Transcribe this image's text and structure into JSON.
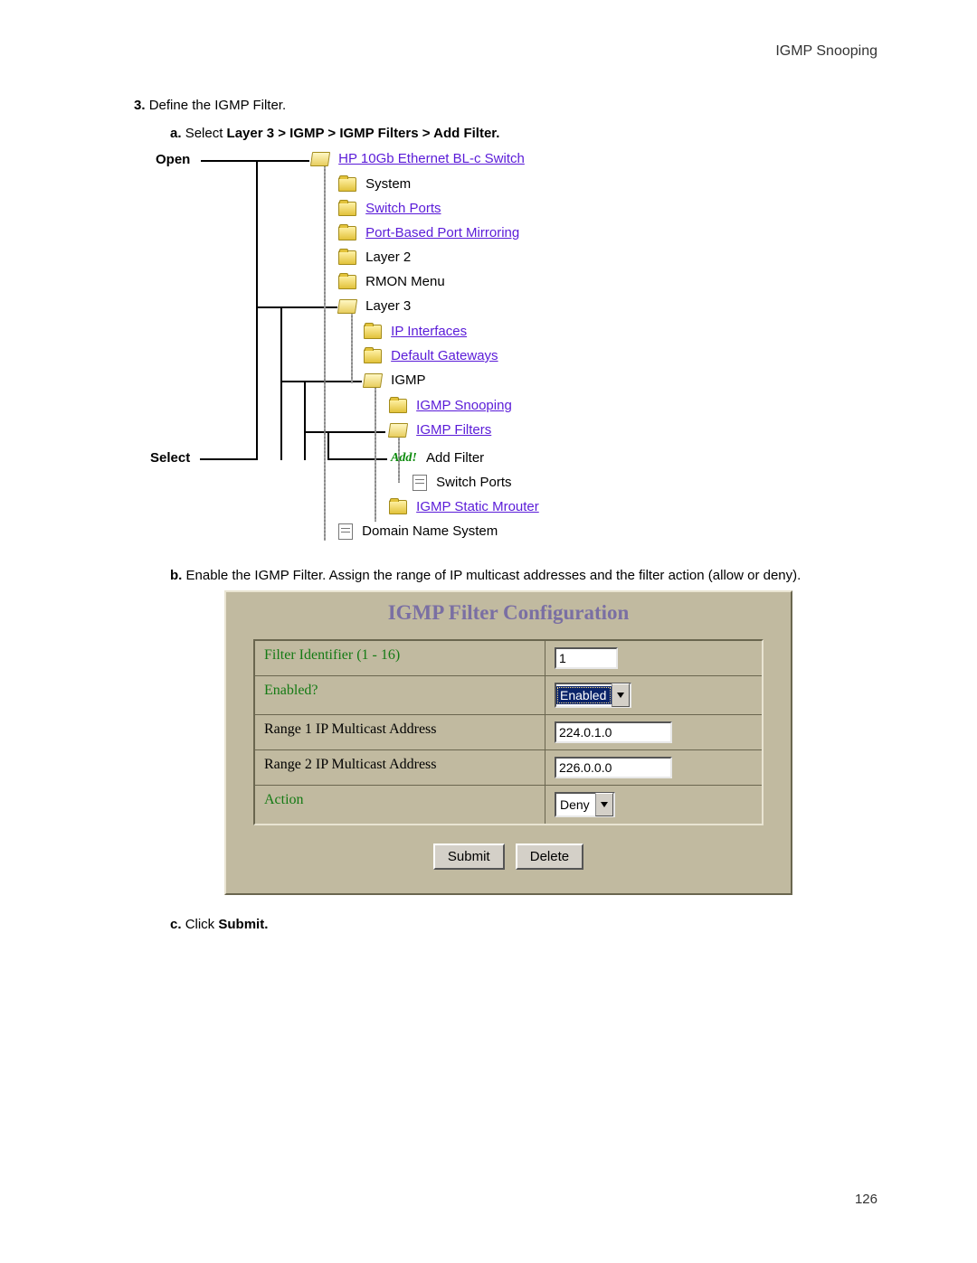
{
  "header": {
    "title": "IGMP Snooping"
  },
  "footer": {
    "page_number": "126"
  },
  "step": {
    "number": "3.",
    "text": "Define the IGMP Filter.",
    "a_marker": "a.",
    "a_prefix": "Select ",
    "a_bold": "Layer 3 > IGMP > IGMP Filters > Add Filter.",
    "b_marker": "b.",
    "b_text": "Enable the IGMP Filter. Assign the range of IP multicast addresses and the filter action (allow or deny).",
    "c_marker": "c.",
    "c_prefix": "Click ",
    "c_bold": "Submit."
  },
  "tree": {
    "open_callout": "Open",
    "select_callout": "Select",
    "root": "HP 10Gb Ethernet BL-c Switch",
    "n_system": "System",
    "n_switch_ports": "Switch Ports",
    "n_port_mirroring": "Port-Based Port Mirroring",
    "n_layer2": "Layer 2",
    "n_rmon": "RMON Menu",
    "n_layer3": "Layer 3",
    "n_ip_if": "IP Interfaces",
    "n_def_gw": "Default Gateways",
    "n_igmp": "IGMP",
    "n_igmp_snoop": "IGMP Snooping",
    "n_igmp_filters": "IGMP Filters",
    "n_add_filter_icon": "Add!",
    "n_add_filter": "Add Filter",
    "n_sp": "Switch Ports",
    "n_static_mrouter": "IGMP Static Mrouter",
    "n_dns": "Domain Name System"
  },
  "form": {
    "title": "IGMP Filter Configuration",
    "rows": {
      "r1_label": "Filter Identifier (1 - 16)",
      "r1_value": "1",
      "r2_label": "Enabled?",
      "r2_value": "Enabled",
      "r3_label": "Range 1 IP Multicast Address",
      "r3_value": "224.0.1.0",
      "r4_label": "Range 2 IP Multicast Address",
      "r4_value": "226.0.0.0",
      "r5_label": "Action",
      "r5_value": "Deny"
    },
    "submit": "Submit",
    "delete": "Delete"
  }
}
